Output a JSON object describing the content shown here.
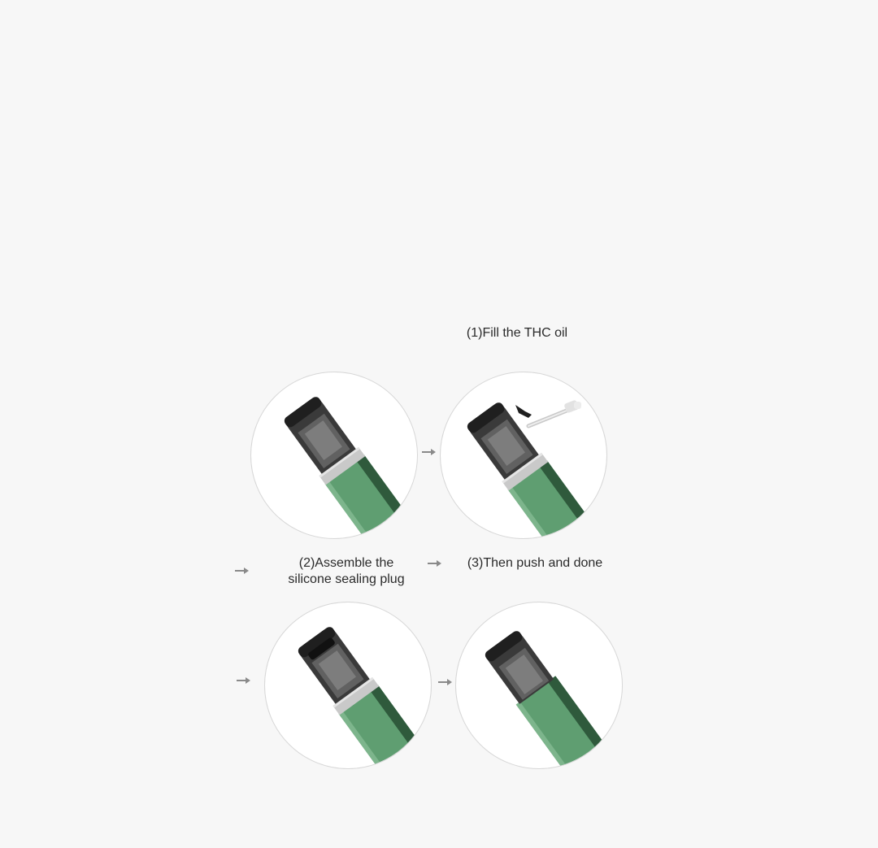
{
  "steps": {
    "fill_label": "(1)Fill the THC oil",
    "assemble_label_line1": "(2)Assemble the",
    "assemble_label_line2": "silicone sealing plug",
    "push_label": "(3)Then push and done"
  },
  "colors": {
    "background": "#f7f7f7",
    "device_green": "#5f9e71",
    "device_green_dark": "#2f5a3c",
    "pod_dark": "#2b2b2b",
    "arrow": "#8a8a8a"
  },
  "icons": {
    "arrow": "arrow-right-icon",
    "dropper": "dropper-icon",
    "plug": "silicone-plug-icon"
  }
}
